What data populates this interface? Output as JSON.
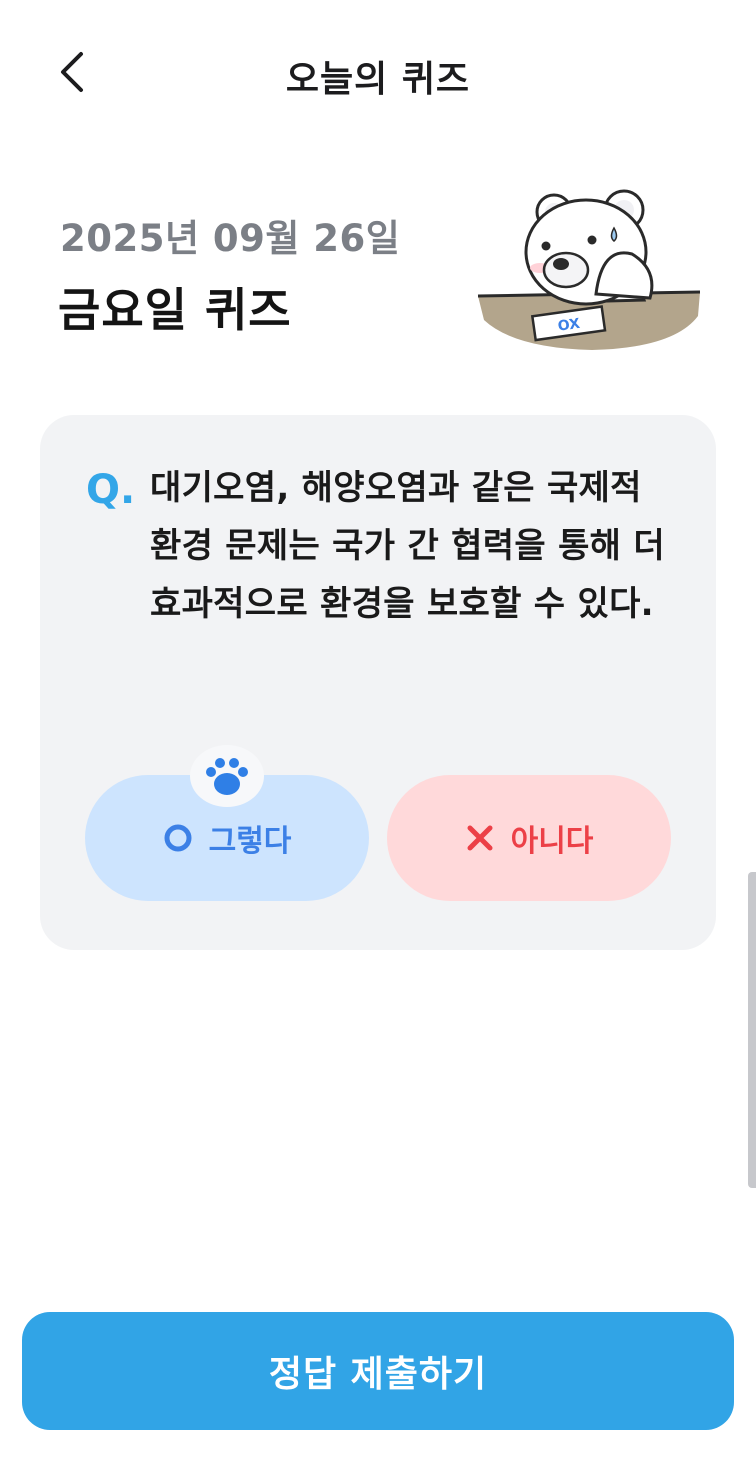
{
  "header": {
    "title": "오늘의 퀴즈",
    "back_icon": "chevron-left-icon"
  },
  "quiz": {
    "date": "2025년 09월 26일",
    "day_title": "금요일 퀴즈",
    "question_prefix": "Q.",
    "question_text": "대기오염, 해양오염과 같은 국제적 환경 문제는 국가 간 협력을 통해 더 효과적으로 환경을 보호할 수 있다.",
    "mascot_paper_text": "OX"
  },
  "options": {
    "yes_label": "그렇다",
    "no_label": "아니다",
    "selected_icon": "paw-icon"
  },
  "submit_label": "정답 제출하기",
  "colors": {
    "accent": "#31a4e6",
    "yes_bg": "#cde4fe",
    "yes_fg": "#3c80e6",
    "no_bg": "#ffd9da",
    "no_fg": "#ec4047",
    "card_bg": "#f2f3f5"
  }
}
